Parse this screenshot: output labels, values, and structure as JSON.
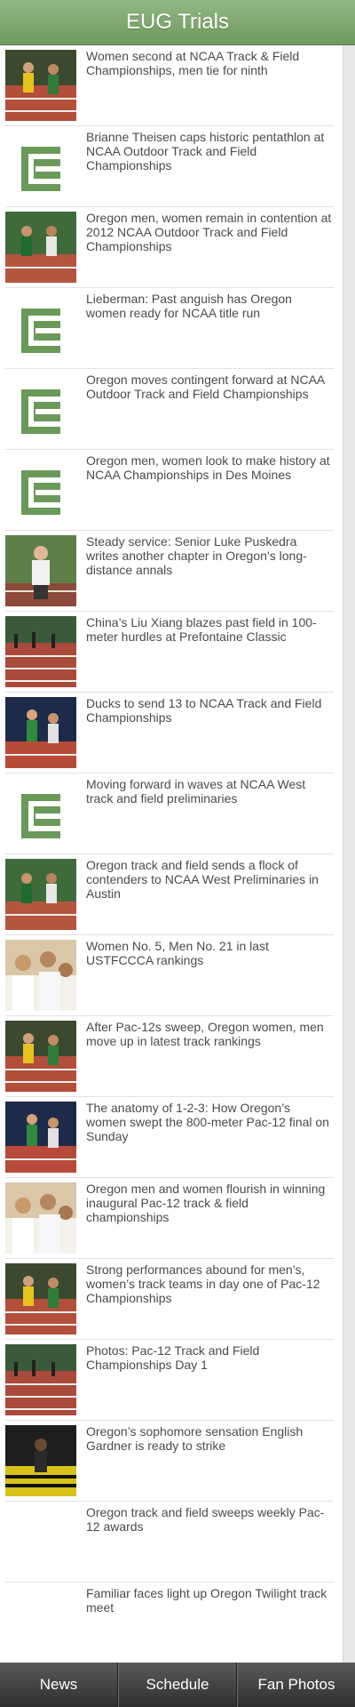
{
  "header": {
    "title": "EUG Trials"
  },
  "articles": [
    {
      "headline": "Women second at NCAA Track & Field Championships, men tie for ninth",
      "thumb": "photo",
      "scene": "track"
    },
    {
      "headline": "Brianne Theisen caps historic pentathlon at NCAA Outdoor Track and Field Championships",
      "thumb": "logo",
      "scene": ""
    },
    {
      "headline": "Oregon men, women remain in contention at 2012 NCAA Outdoor Track and Field Championships",
      "thumb": "photo",
      "scene": "runners-green"
    },
    {
      "headline": "Lieberman: Past anguish has Oregon women ready for NCAA title run",
      "thumb": "logo",
      "scene": ""
    },
    {
      "headline": "Oregon moves contingent forward at NCAA Outdoor Track and Field Championships",
      "thumb": "logo",
      "scene": ""
    },
    {
      "headline": "Oregon men, women look to make history at NCAA Championships in Des Moines",
      "thumb": "logo",
      "scene": ""
    },
    {
      "headline": "Steady service: Senior Luke Puskedra writes another chapter in Oregon’s long-distance annals",
      "thumb": "photo",
      "scene": "portrait"
    },
    {
      "headline": "China’s Liu Xiang blazes past field in 100-meter hurdles at Prefontaine Classic",
      "thumb": "photo",
      "scene": "hurdles"
    },
    {
      "headline": "Ducks to send 13 to NCAA Track and Field Championships",
      "thumb": "photo",
      "scene": "runners-dark"
    },
    {
      "headline": "Moving forward in waves at NCAA West track and field preliminaries",
      "thumb": "logo",
      "scene": ""
    },
    {
      "headline": "Oregon track and field sends a flock of contenders to NCAA West Preliminaries in Austin",
      "thumb": "photo",
      "scene": "runners-green"
    },
    {
      "headline": "Women No. 5, Men No. 21 in last USTFCCCA rankings",
      "thumb": "photo",
      "scene": "crowd"
    },
    {
      "headline": "After Pac-12s sweep, Oregon women, men move up in latest track rankings",
      "thumb": "photo",
      "scene": "track"
    },
    {
      "headline": "The anatomy of 1-2-3: How Oregon’s women swept the 800-meter Pac-12 final on Sunday",
      "thumb": "photo",
      "scene": "runners-dark"
    },
    {
      "headline": "Oregon men and women flourish in winning inaugural Pac-12 track & field championships",
      "thumb": "photo",
      "scene": "crowd"
    },
    {
      "headline": "Strong performances abound for men’s, women’s track teams in day one of Pac-12 Championships",
      "thumb": "photo",
      "scene": "track"
    },
    {
      "headline": "Photos: Pac-12 Track and Field Championships Day 1",
      "thumb": "photo",
      "scene": "hurdles"
    },
    {
      "headline": "Oregon’s sophomore sensation English Gardner is ready to strike",
      "thumb": "photo",
      "scene": "yellow"
    },
    {
      "headline": "Oregon track and field sweeps weekly Pac-12 awards",
      "thumb": "blank",
      "scene": ""
    },
    {
      "headline": "Familiar faces light up Oregon Twilight track meet",
      "thumb": "blank",
      "scene": ""
    }
  ],
  "tabs": [
    "News",
    "Schedule",
    "Fan Photos"
  ],
  "colors": {
    "header": "#7fa86f",
    "logo_green": "#6a9a58",
    "headline_text": "#4b4b4b",
    "tabbar": "#3a3a3a"
  }
}
